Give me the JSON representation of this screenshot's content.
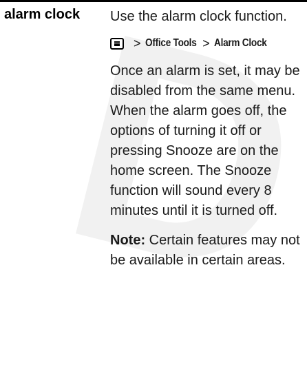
{
  "entry": {
    "term": "alarm clock",
    "intro": "Use the alarm clock function.",
    "path": {
      "icon": "menu-key-icon",
      "separator": ">",
      "items": [
        "Office Tools",
        "Alarm Clock"
      ]
    },
    "body": "Once an alarm is set, it may be disabled from the same menu. When the alarm goes off, the options of turning it off or pressing Snooze are on the home screen. The Snooze function will sound every 8 minutes until it is turned off.",
    "note": {
      "label": "Note:",
      "text": " Certain features may not be available in certain areas."
    }
  }
}
